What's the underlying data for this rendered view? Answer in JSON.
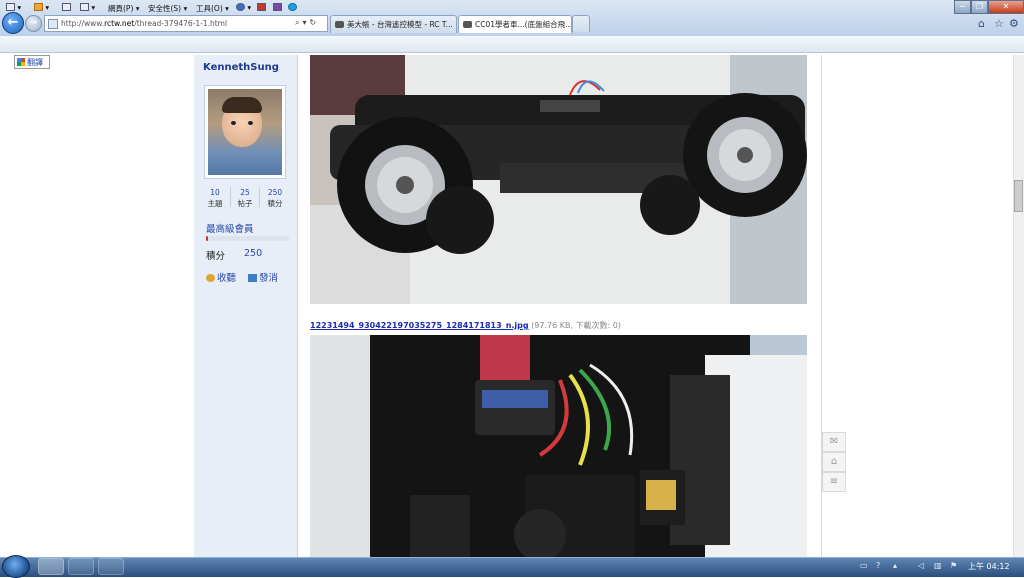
{
  "browser": {
    "url_prefix": "http://www.",
    "url_domain": "rctw.net",
    "url_path": "/thread-379476-1-1.html",
    "tabs": [
      {
        "label": "美大帳 - 台灣遙控模型 - RC T..."
      },
      {
        "label": "CC01學者車...(底盤組合飛..."
      }
    ],
    "command_bar": {
      "page": "網頁(P)",
      "safety": "安全性(S)",
      "tools": "工具(O)"
    },
    "window_buttons": {
      "minimize": "─",
      "maximize": "❐",
      "close": "✕"
    }
  },
  "translate_label": "翻譯",
  "profile": {
    "username": "KennethSung",
    "stats": [
      {
        "value": "10",
        "label": "主題"
      },
      {
        "value": "25",
        "label": "帖子"
      },
      {
        "value": "250",
        "label": "積分"
      }
    ],
    "rank": "最高級會員",
    "rank_progress": 0.03,
    "points_label": "積分",
    "points_value": "250",
    "actions": {
      "favorite": "收聽",
      "message": "發消"
    }
  },
  "attachment": {
    "filename": "12231494_930422197035275_1284171813_n.jpg",
    "meta": " (97.76 KB, 下載次數: 0)"
  },
  "taskbar": {
    "clock": "上午 04:12"
  },
  "colors": {
    "link": "#1a2bb0",
    "accent": "#2748a6",
    "sidebar_bg": "#e7eef7"
  },
  "icons": [
    "back-icon",
    "forward-icon",
    "search-icon",
    "refresh-icon",
    "home-icon",
    "star-icon",
    "gear-icon",
    "comment-icon",
    "bookmark-icon",
    "list-icon",
    "start-orb-icon"
  ]
}
